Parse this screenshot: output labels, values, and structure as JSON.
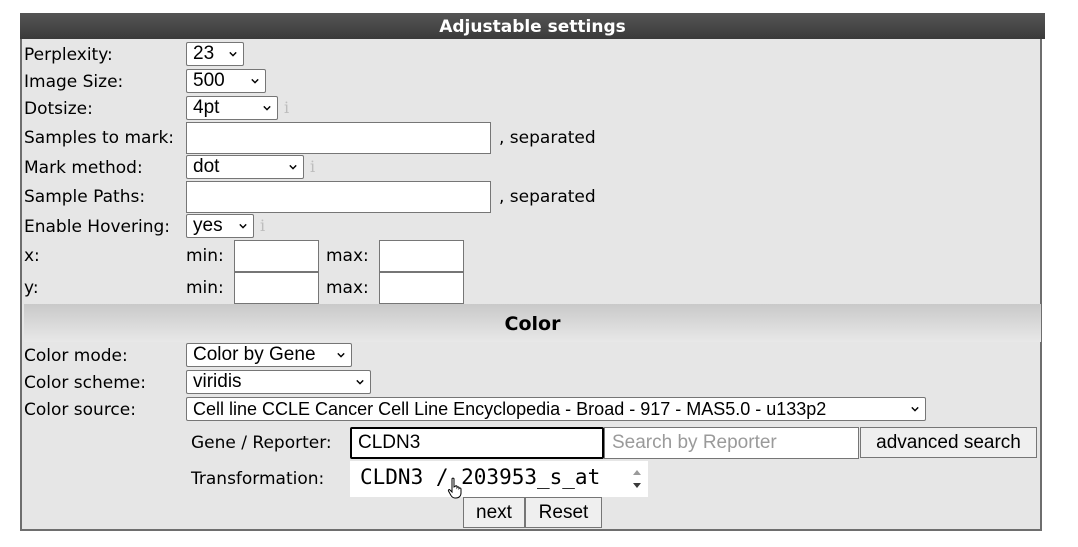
{
  "header": {
    "title": "Adjustable settings"
  },
  "settings": {
    "perplexity": {
      "label": "Perplexity:",
      "value": "23"
    },
    "image_size": {
      "label": "Image Size:",
      "value": "500"
    },
    "dotsize": {
      "label": "Dotsize:",
      "value": "4pt",
      "info": "i"
    },
    "samples_to_mark": {
      "label": "Samples to mark:",
      "value": "",
      "note": ", separated"
    },
    "mark_method": {
      "label": "Mark method:",
      "value": "dot",
      "info": "i"
    },
    "sample_paths": {
      "label": "Sample Paths:",
      "value": "",
      "note": ", separated"
    },
    "enable_hovering": {
      "label": "Enable Hovering:",
      "value": "yes",
      "info": "i"
    },
    "x": {
      "label": "x:",
      "min_label": "min:",
      "max_label": "max:"
    },
    "y": {
      "label": "y:",
      "min_label": "min:",
      "max_label": "max:"
    }
  },
  "color": {
    "title": "Color",
    "mode": {
      "label": "Color mode:",
      "value": "Color by Gene"
    },
    "scheme": {
      "label": "Color scheme:",
      "value": "viridis"
    },
    "source": {
      "label": "Color source:",
      "value": "Cell line CCLE Cancer Cell Line Encyclopedia - Broad - 917 - MAS5.0 - u133p2"
    },
    "gene": {
      "label": "Gene / Reporter:",
      "value": "CLDN3",
      "search_placeholder": "Search by Reporter",
      "advanced": "advanced search"
    },
    "transformation": {
      "label": "Transformation:",
      "option": "CLDN3 / 203953_s_at"
    }
  },
  "buttons": {
    "next": "next",
    "reset": "Reset"
  }
}
